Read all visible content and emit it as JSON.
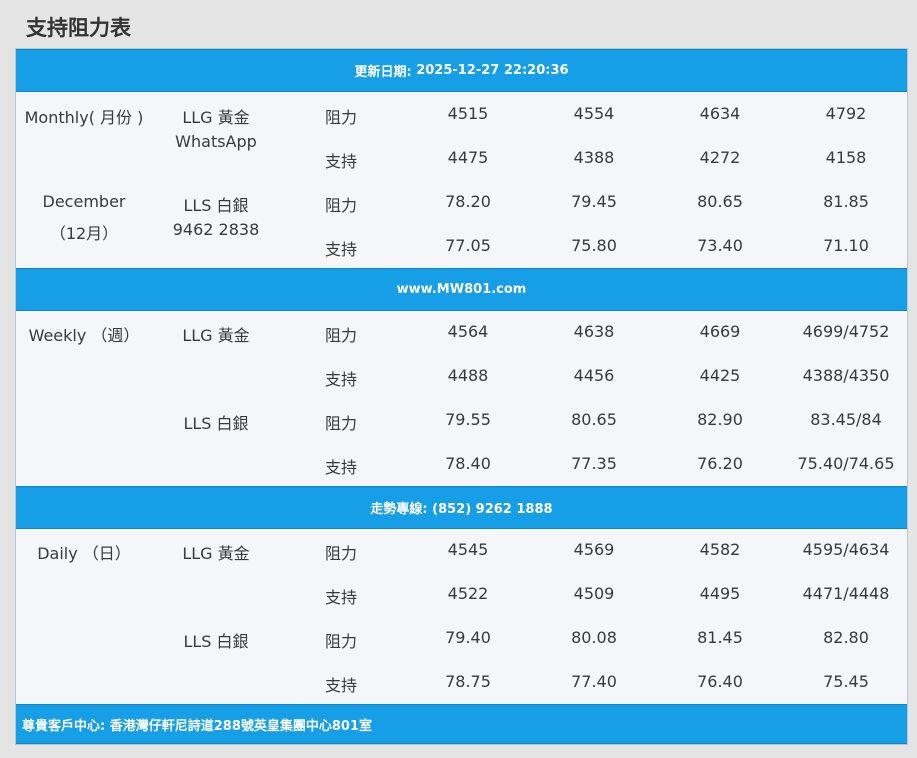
{
  "page_title": "支持阻力表",
  "bands": {
    "update_label": "更新日期:",
    "update_value": "2025-12-27 22:20:36",
    "website": "www.MW801.com",
    "hotline": "走勢專線: (852) 9262 1888",
    "address": "尊貴客戶中心: 香港灣仔軒尼詩道288號英皇集團中心801室"
  },
  "monthly": {
    "period_line1": "Monthly( 月份 )",
    "period_line2": "December",
    "period_line3": "（12月）",
    "gold_label": "LLG 黃金",
    "gold_sub": "WhatsApp",
    "silver_label": "LLS 白銀",
    "silver_sub": "9462 2838",
    "rows": [
      {
        "type": "阻力",
        "values": [
          "4515",
          "4554",
          "4634",
          "4792"
        ]
      },
      {
        "type": "支持",
        "values": [
          "4475",
          "4388",
          "4272",
          "4158"
        ]
      },
      {
        "type": "阻力",
        "values": [
          "78.20",
          "79.45",
          "80.65",
          "81.85"
        ]
      },
      {
        "type": "支持",
        "values": [
          "77.05",
          "75.80",
          "73.40",
          "71.10"
        ]
      }
    ]
  },
  "weekly": {
    "period": "Weekly （週）",
    "gold_label": "LLG 黃金",
    "silver_label": "LLS 白銀",
    "rows": [
      {
        "type": "阻力",
        "values": [
          "4564",
          "4638",
          "4669",
          "4699/4752"
        ]
      },
      {
        "type": "支持",
        "values": [
          "4488",
          "4456",
          "4425",
          "4388/4350"
        ]
      },
      {
        "type": "阻力",
        "values": [
          "79.55",
          "80.65",
          "82.90",
          "83.45/84"
        ]
      },
      {
        "type": "支持",
        "values": [
          "78.40",
          "77.35",
          "76.20",
          "75.40/74.65"
        ]
      }
    ]
  },
  "daily": {
    "period": "Daily （日）",
    "gold_label": "LLG 黃金",
    "silver_label": "LLS 白銀",
    "rows": [
      {
        "type": "阻力",
        "values": [
          "4545",
          "4569",
          "4582",
          "4595/4634"
        ]
      },
      {
        "type": "支持",
        "values": [
          "4522",
          "4509",
          "4495",
          "4471/4448"
        ]
      },
      {
        "type": "阻力",
        "values": [
          "79.40",
          "80.08",
          "81.45",
          "82.80"
        ]
      },
      {
        "type": "支持",
        "values": [
          "78.75",
          "77.40",
          "76.40",
          "75.45"
        ]
      }
    ]
  },
  "colors": {
    "band_blue": "#169fe6",
    "table_bg": "#f4f6f9",
    "page_bg": "#e4e4e4",
    "text": "#3a3a3a"
  }
}
